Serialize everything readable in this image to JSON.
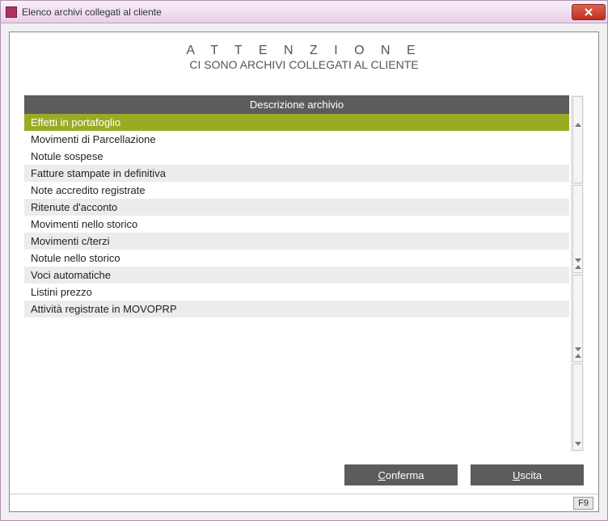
{
  "window": {
    "title": "Elenco archivi collegati al cliente"
  },
  "alert": {
    "title": "A T T E N Z I O N E",
    "subtitle": "CI SONO ARCHIVI COLLEGATI AL CLIENTE"
  },
  "table": {
    "header": "Descrizione archivio",
    "rows": [
      "Effetti in portafoglio",
      "Movimenti di Parcellazione",
      "Notule sospese",
      "Fatture stampate in definitiva",
      "Note accredito registrate",
      "Ritenute d'acconto",
      "Movimenti nello storico",
      "Movimenti c/terzi",
      "Notule nello storico",
      "Voci automatiche",
      "Listini prezzo",
      "Attività registrate in MOVOPRP"
    ],
    "selected_index": 0
  },
  "buttons": {
    "confirm": {
      "accel": "C",
      "rest": "onferma"
    },
    "exit": {
      "accel": "U",
      "rest": "scita"
    }
  },
  "statusbar": {
    "hint": "F9"
  }
}
